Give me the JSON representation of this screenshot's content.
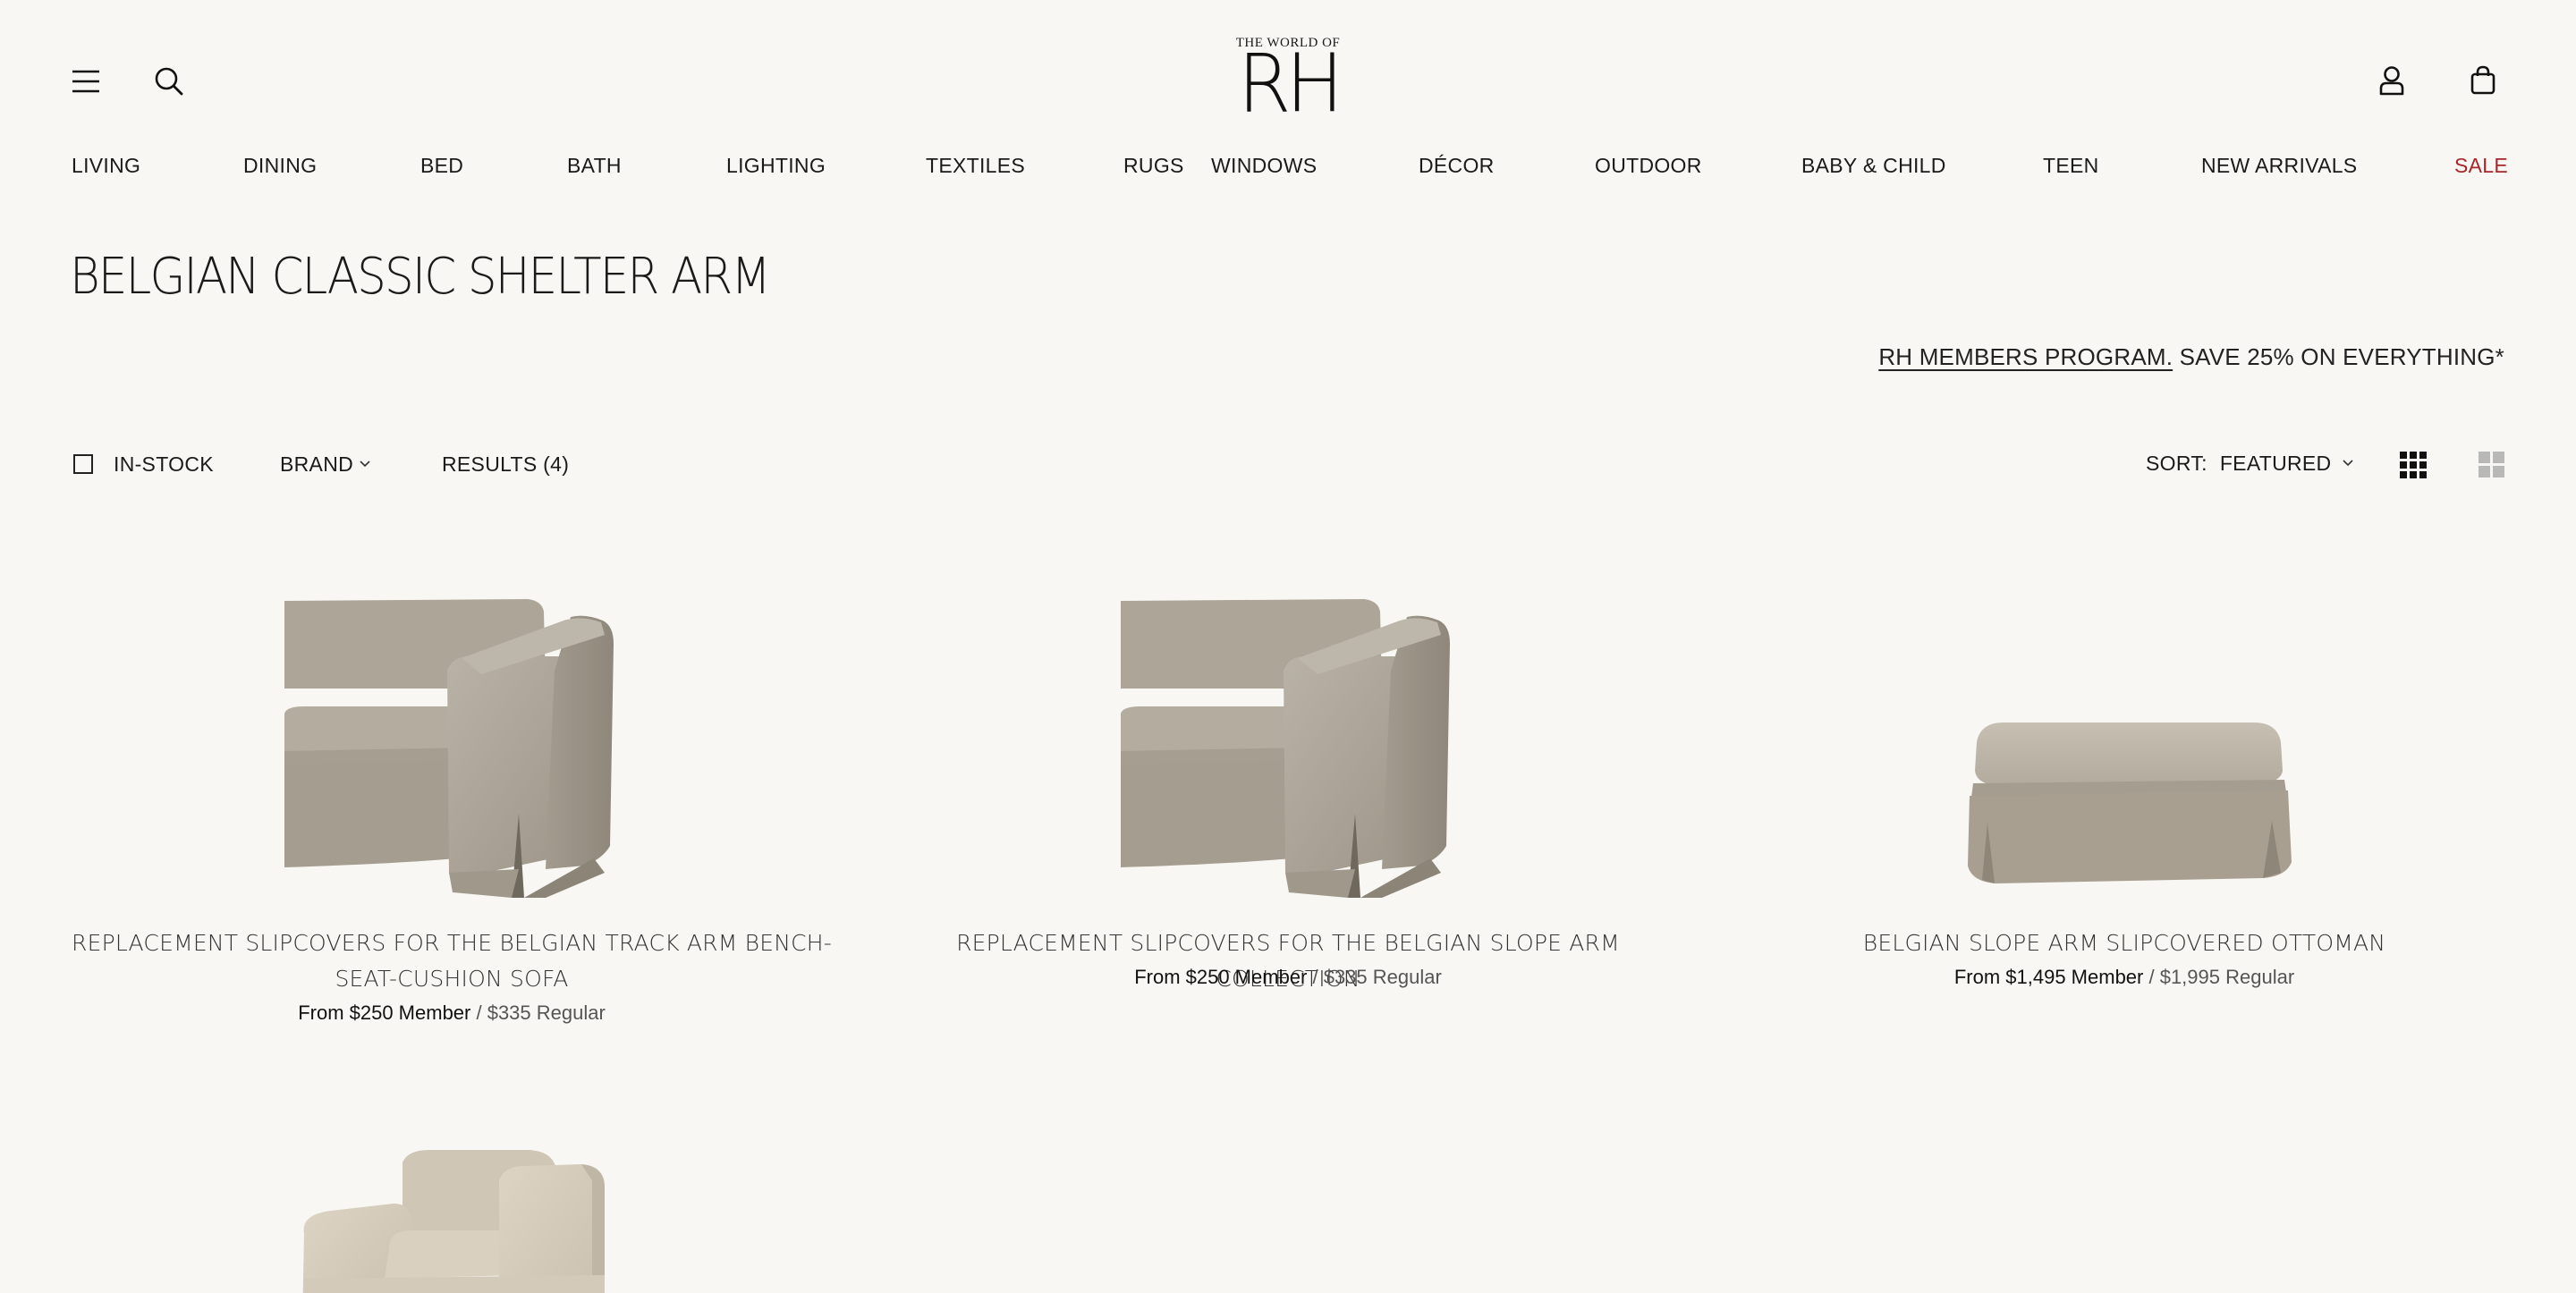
{
  "header": {
    "logo_small": "THE WORLD OF",
    "logo_big": "RH",
    "icons": {
      "menu": "menu-icon",
      "search": "search-icon",
      "account": "user-icon",
      "cart": "shopping-bag-icon"
    }
  },
  "nav": {
    "items": [
      "LIVING",
      "DINING",
      "BED",
      "BATH",
      "LIGHTING",
      "TEXTILES",
      "RUGS",
      "WINDOWS",
      "DÉCOR",
      "OUTDOOR",
      "BABY & CHILD",
      "TEEN",
      "NEW ARRIVALS",
      "SALE"
    ],
    "sale_color": "#a8262a"
  },
  "page": {
    "title": "BELGIAN CLASSIC SHELTER ARM"
  },
  "promo": {
    "link_text": "RH MEMBERS PROGRAM.",
    "text": " SAVE 25% ON EVERYTHING*"
  },
  "filters": {
    "in_stock_label": "IN-STOCK",
    "in_stock_checked": false,
    "brand_label": "BRAND",
    "results_label": "RESULTS (4)",
    "sort_label": "SORT:",
    "sort_value": "FEATURED",
    "grid_view_selected": "three-column"
  },
  "products": [
    {
      "name_line1": "REPLACEMENT SLIPCOVERS FOR THE BELGIAN TRACK ARM BENCH-",
      "name_line2": "SEAT-CUSHION SOFA",
      "price_member": "From $250 Member",
      "price_regular": " / $335 Regular",
      "image": "slipcovered-sofa-arm"
    },
    {
      "name": "REPLACEMENT SLIPCOVERS FOR THE BELGIAN SLOPE ARM COLLECTION",
      "price_member": "From $250 Member",
      "price_regular": " / $335 Regular",
      "image": "slipcovered-sofa-arm"
    },
    {
      "name": "BELGIAN SLOPE ARM SLIPCOVERED OTTOMAN",
      "price_member": "From $1,495 Member",
      "price_regular": " / $1,995 Regular",
      "image": "slipcovered-ottoman"
    },
    {
      "image": "slipcovered-chair"
    }
  ],
  "colors": {
    "background": "#f8f7f3",
    "fabric": "#a9a195",
    "sale": "#a8262a"
  }
}
